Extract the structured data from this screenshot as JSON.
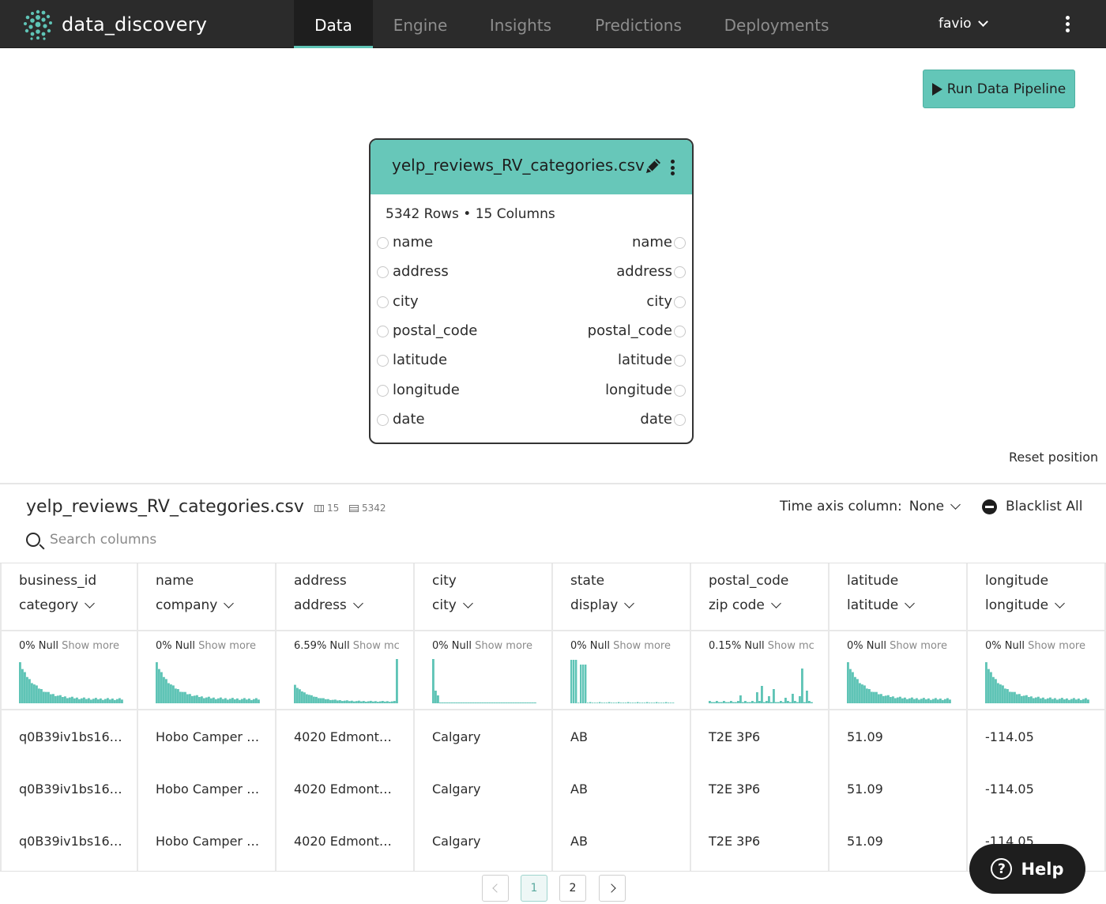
{
  "app": {
    "name": "data_discovery"
  },
  "nav": {
    "tabs": [
      {
        "label": "Data",
        "active": true
      },
      {
        "label": "Engine",
        "active": false
      },
      {
        "label": "Insights",
        "active": false
      },
      {
        "label": "Predictions",
        "active": false
      },
      {
        "label": "Deployments",
        "active": false
      }
    ],
    "user": "favio"
  },
  "pipeline": {
    "run_label": "Run Data Pipeline",
    "reset_label": "Reset position"
  },
  "node": {
    "title": "yelp_reviews_RV_categories.csv",
    "meta": "5342 Rows • 15 Columns",
    "ports": [
      "name",
      "address",
      "city",
      "postal_code",
      "latitude",
      "longitude",
      "date"
    ]
  },
  "dataset": {
    "title": "yelp_reviews_RV_categories.csv",
    "columns_count": "15",
    "rows_count": "5342",
    "time_axis_label": "Time axis column:",
    "time_axis_value": "None",
    "blacklist_label": "Blacklist All",
    "search_placeholder": "Search columns"
  },
  "columns": [
    {
      "name": "business_id",
      "type": "category",
      "null": "0% Null",
      "more": "Show more",
      "hist": "decay",
      "cells": [
        "q0B39iv1bs16…",
        "q0B39iv1bs16…",
        "q0B39iv1bs16…"
      ]
    },
    {
      "name": "name",
      "type": "company",
      "null": "0% Null",
      "more": "Show more",
      "hist": "decay",
      "cells": [
        "Hobo Camper …",
        "Hobo Camper …",
        "Hobo Camper …"
      ]
    },
    {
      "name": "address",
      "type": "address",
      "null": "6.59% Null",
      "more": "Show mc",
      "hist": "decay-spike",
      "cells": [
        "4020 Edmonto…",
        "4020 Edmonto…",
        "4020 Edmonto…"
      ]
    },
    {
      "name": "city",
      "type": "city",
      "null": "0% Null",
      "more": "Show more",
      "hist": "single",
      "cells": [
        "Calgary",
        "Calgary",
        "Calgary"
      ]
    },
    {
      "name": "state",
      "type": "display",
      "null": "0% Null",
      "more": "Show more",
      "hist": "two-bars",
      "cells": [
        "AB",
        "AB",
        "AB"
      ]
    },
    {
      "name": "postal_code",
      "type": "zip code",
      "null": "0.15% Null",
      "more": "Show mc",
      "hist": "sparse",
      "cells": [
        "T2E 3P6",
        "T2E 3P6",
        "T2E 3P6"
      ]
    },
    {
      "name": "latitude",
      "type": "latitude",
      "null": "0% Null",
      "more": "Show more",
      "hist": "decay",
      "cells": [
        "51.09",
        "51.09",
        "51.09"
      ]
    },
    {
      "name": "longitude",
      "type": "longitude",
      "null": "0% Null",
      "more": "Show more",
      "hist": "decay",
      "cells": [
        "-114.05",
        "-114.05",
        "-114.05"
      ]
    }
  ],
  "pagination": {
    "pages": [
      "1",
      "2"
    ],
    "current": "1"
  },
  "help": {
    "label": "Help",
    "glyph": "?"
  },
  "icons": {
    "accent": "#63c6b8",
    "histogram": "#5fc4b6",
    "nav_bg": "#2b2b2b"
  }
}
